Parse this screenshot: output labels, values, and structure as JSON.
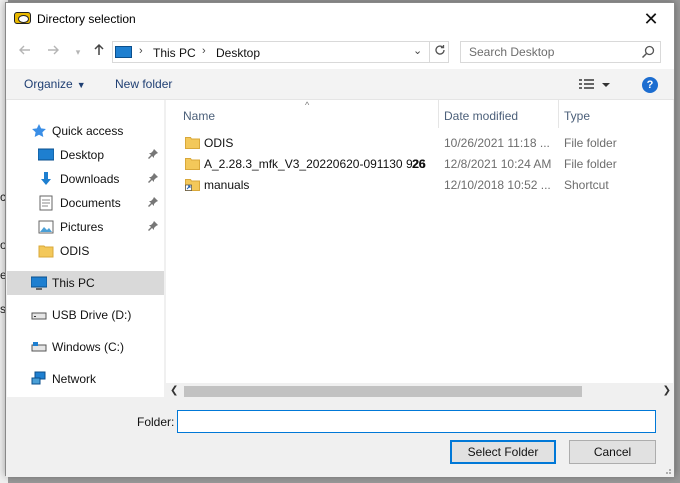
{
  "background": {
    "fragments": [
      "c",
      "o",
      "e",
      "s"
    ]
  },
  "dialog": {
    "title": "Directory selection",
    "close_glyph": "✕"
  },
  "address": {
    "crumbs": [
      "This PC",
      "Desktop"
    ],
    "search_placeholder": "Search Desktop"
  },
  "commands": {
    "organize": "Organize",
    "new_folder": "New folder"
  },
  "nav": {
    "items": [
      {
        "label": "Quick access",
        "icon": "star-icon"
      },
      {
        "label": "Desktop",
        "icon": "desktop-icon",
        "pinned": true
      },
      {
        "label": "Downloads",
        "icon": "download-icon",
        "pinned": true
      },
      {
        "label": "Documents",
        "icon": "document-icon",
        "pinned": true
      },
      {
        "label": "Pictures",
        "icon": "pictures-icon",
        "pinned": true
      },
      {
        "label": "ODIS",
        "icon": "folder-icon"
      },
      {
        "label": "This PC",
        "icon": "pc-icon",
        "selected": true
      },
      {
        "label": "USB Drive (D:)",
        "icon": "usb-drive-icon"
      },
      {
        "label": "Windows (C:)",
        "icon": "disk-drive-icon"
      },
      {
        "label": "Network",
        "icon": "network-icon"
      }
    ]
  },
  "columns": {
    "name": "Name",
    "date": "Date modified",
    "type": "Type"
  },
  "files": [
    {
      "name": "ODIS",
      "date": "10/26/2021 11:18 ...",
      "type": "File folder",
      "icon": "folder-icon"
    },
    {
      "name": "A_2.28.3_mfk_V3_20220620-091130 926",
      "badge": "26",
      "date": "12/8/2021 10:24 AM",
      "type": "File folder",
      "icon": "folder-icon"
    },
    {
      "name": "manuals",
      "date": "12/10/2018 10:52 ...",
      "type": "Shortcut",
      "icon": "shortcut-folder-icon"
    }
  ],
  "bottom": {
    "folder_label": "Folder:",
    "folder_value": "",
    "select_button": "Select Folder",
    "cancel_button": "Cancel"
  },
  "colors": {
    "accent": "#0078d7",
    "folder": "#f3c85a",
    "link": "#1f3f73"
  }
}
